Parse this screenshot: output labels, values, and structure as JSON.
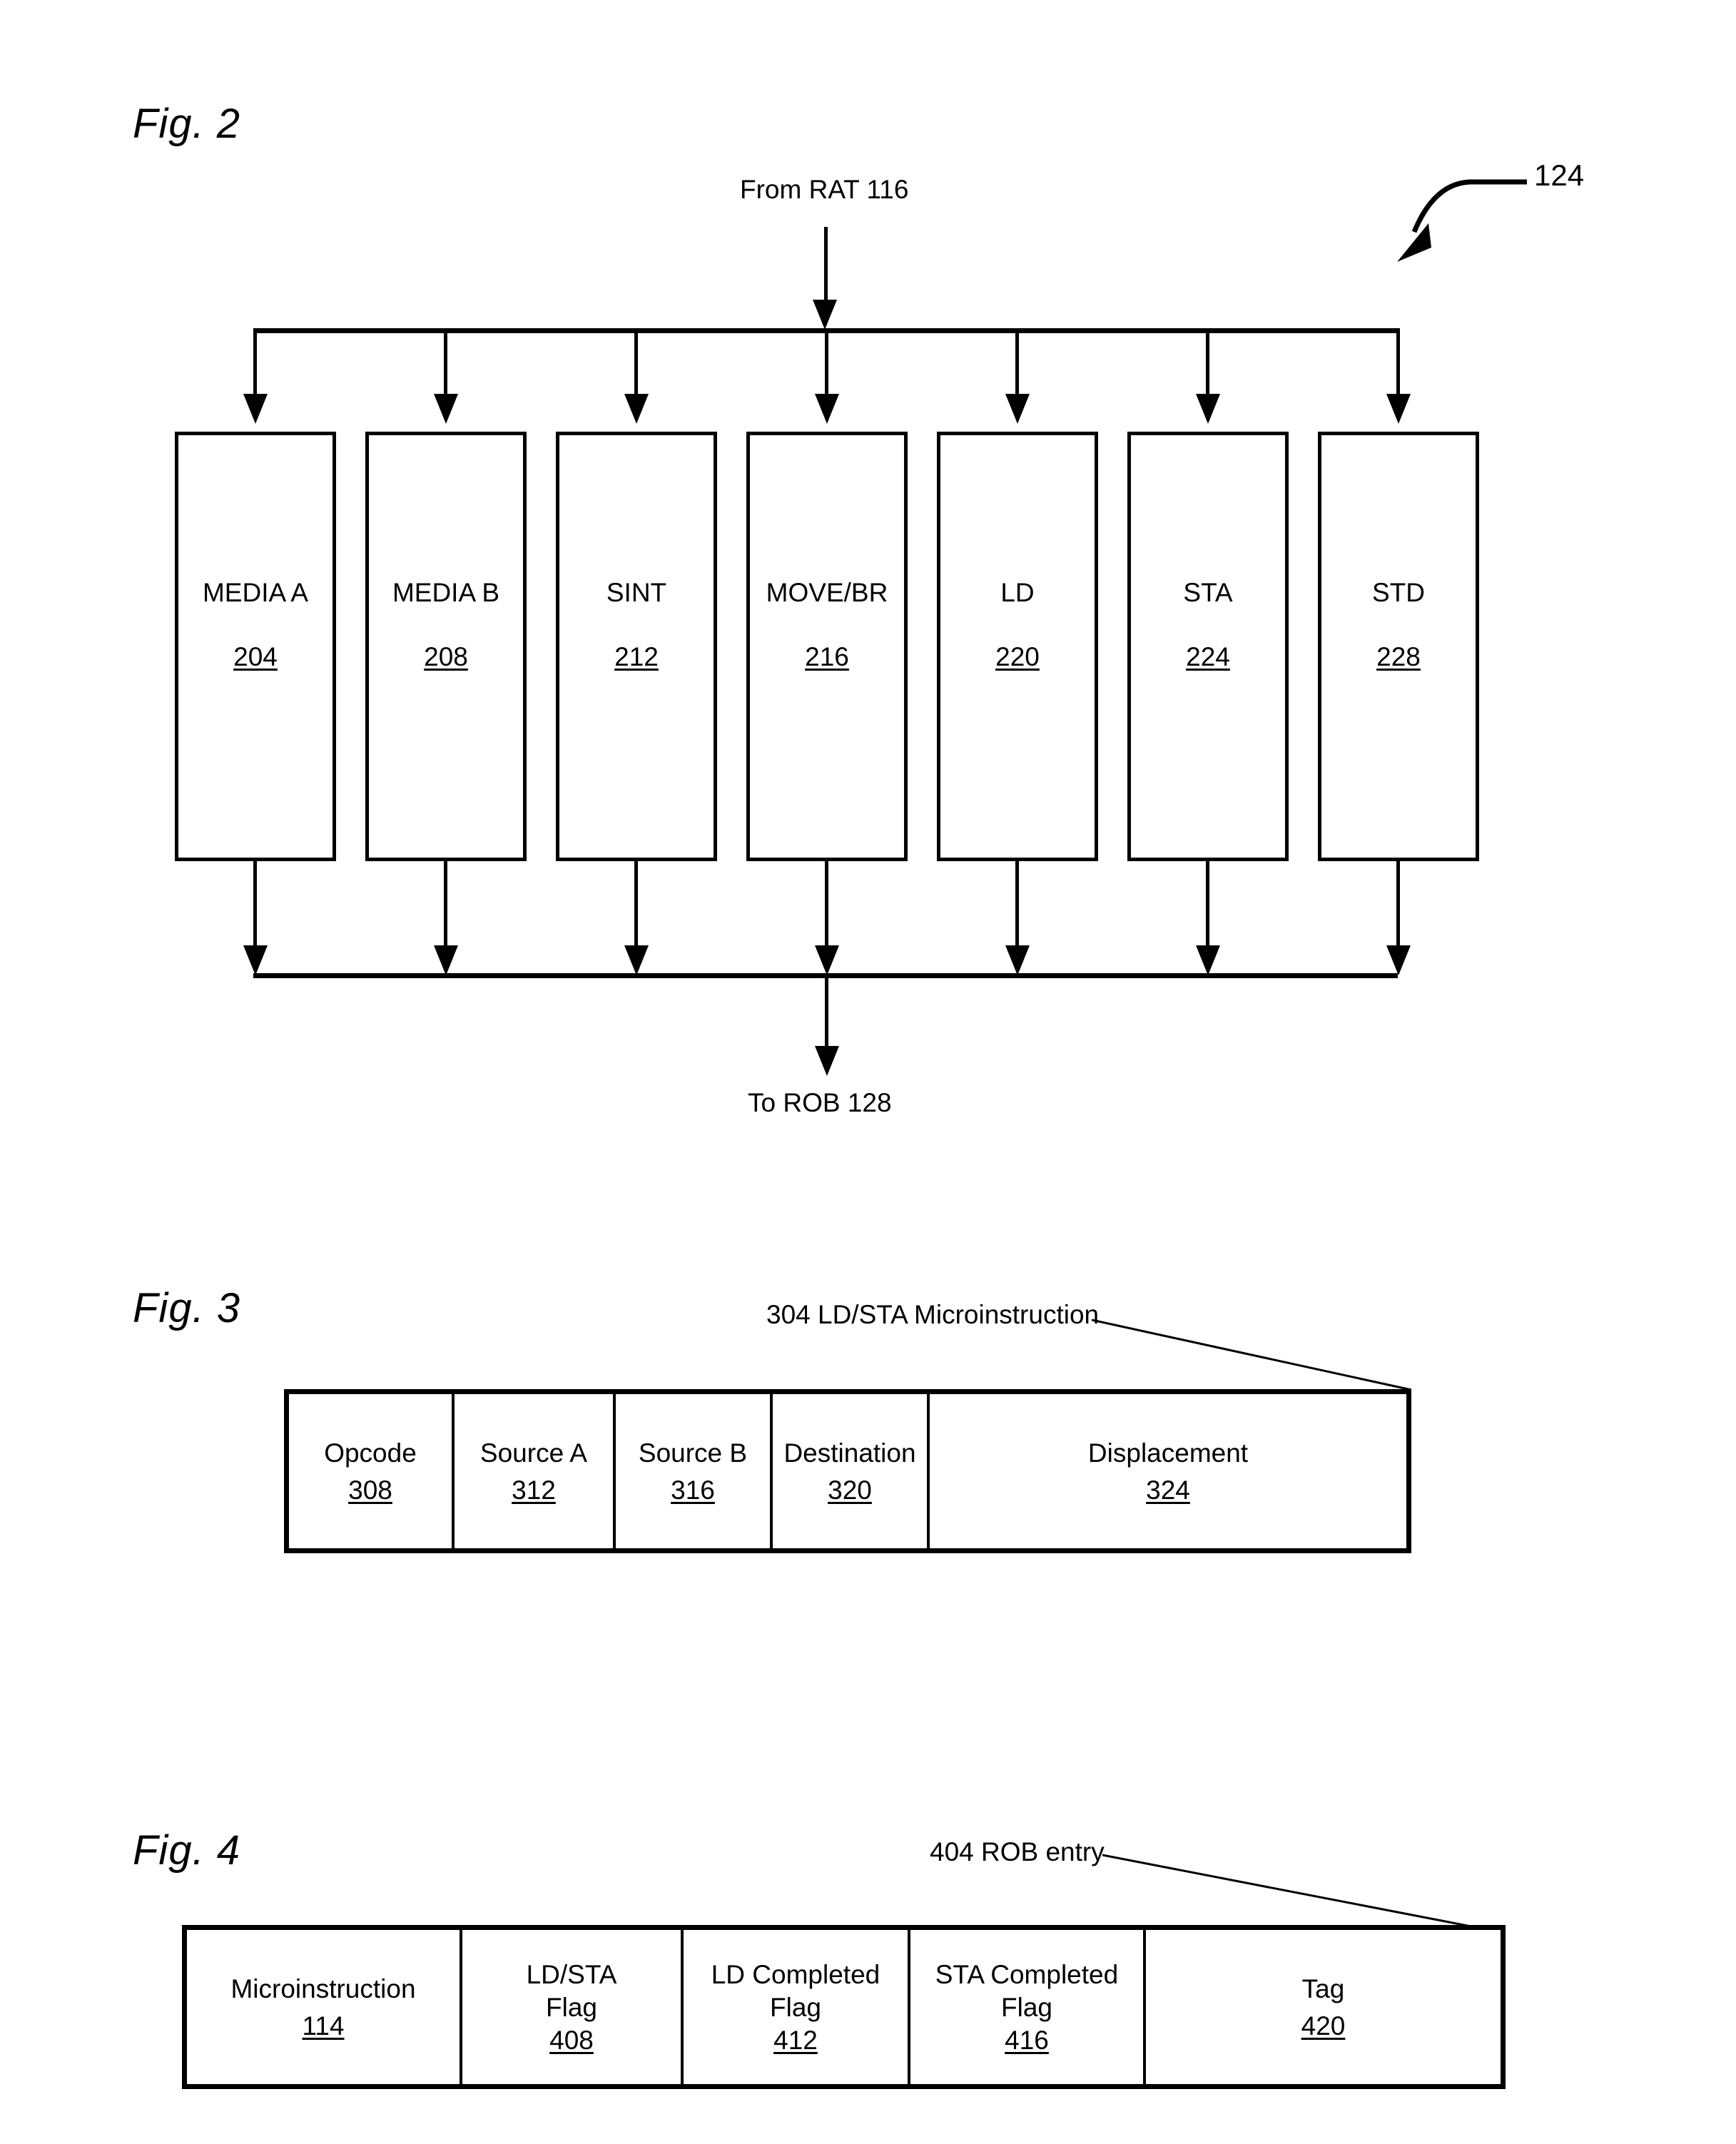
{
  "figures": [
    {
      "caption": "Fig. 2",
      "input_label": "From RAT 116",
      "output_label": "To ROB 128",
      "assembly_ref": "124",
      "units": [
        {
          "title": "MEDIA A",
          "ref": "204"
        },
        {
          "title": "MEDIA B",
          "ref": "208"
        },
        {
          "title": "SINT",
          "ref": "212"
        },
        {
          "title": "MOVE/BR",
          "ref": "216"
        },
        {
          "title": "LD",
          "ref": "220"
        },
        {
          "title": "STA",
          "ref": "224"
        },
        {
          "title": "STD",
          "ref": "228"
        }
      ]
    },
    {
      "caption": "Fig. 3",
      "title_label": "304  LD/STA Microinstruction",
      "fields": [
        {
          "label": "Opcode",
          "ref": "308"
        },
        {
          "label": "Source A",
          "ref": "312"
        },
        {
          "label": "Source B",
          "ref": "316"
        },
        {
          "label": "Destination",
          "ref": "320"
        },
        {
          "label": "Displacement",
          "ref": "324"
        }
      ]
    },
    {
      "caption": "Fig. 4",
      "title_label": "404 ROB entry",
      "fields": [
        {
          "label": "Microinstruction",
          "ref": "114"
        },
        {
          "label": "LD/STA\nFlag",
          "ref": "408"
        },
        {
          "label": "LD Completed\nFlag",
          "ref": "412"
        },
        {
          "label": "STA Completed\nFlag",
          "ref": "416"
        },
        {
          "label": "Tag",
          "ref": "420"
        }
      ]
    }
  ]
}
